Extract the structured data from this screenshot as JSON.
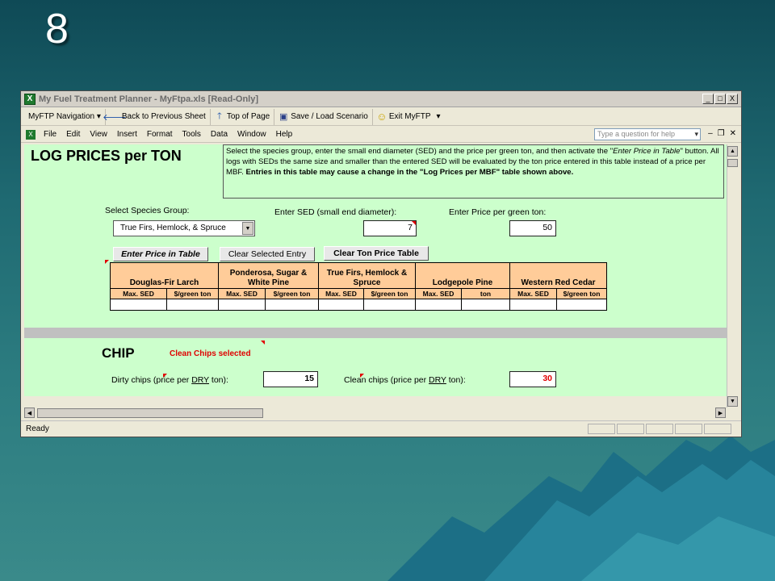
{
  "slide": {
    "number": "8"
  },
  "window": {
    "title": "My Fuel Treatment Planner - MyFtpa.xls  [Read-Only]",
    "buttons": [
      "_",
      "□",
      "X"
    ]
  },
  "toolbar": {
    "items": [
      {
        "label": "MyFTP  Navigation ▾",
        "icon": ""
      },
      {
        "label": "Back to Previous Sheet",
        "icon": "back-arrow-icon"
      },
      {
        "label": "Top of Page",
        "icon": "up-arrow-icon"
      },
      {
        "label": "Save / Load Scenario",
        "icon": "save-icon"
      },
      {
        "label": "Exit MyFTP",
        "icon": "smiley-icon"
      }
    ]
  },
  "menubar": {
    "items": [
      "File",
      "Edit",
      "View",
      "Insert",
      "Format",
      "Tools",
      "Data",
      "Window",
      "Help"
    ],
    "help_placeholder": "Type a question for help"
  },
  "sheet": {
    "log_heading": "LOG PRICES per TON",
    "instructions_plain": "Select the species group, enter the small end diameter (SED) and the price per green ton, and then activate the \"",
    "instructions_italic": "Enter Price in Table",
    "instructions_mid": "\" button.  All logs with SEDs the same size and smaller than the entered SED will be evaluated by the ton price entered in this table instead of a price per MBF.  ",
    "instructions_bold": "Entries in this table may cause a change in the \"Log Prices per MBF\" table shown above.",
    "species_label": "Select Species Group:",
    "species_value": "True Firs, Hemlock, & Spruce",
    "sed_label": "Enter SED (small end diameter):",
    "sed_value": "7",
    "price_label": "Enter Price per green ton:",
    "price_value": "50",
    "btn_enter": "Enter Price in Table",
    "btn_clear_entry": "Clear Selected Entry",
    "btn_clear_table": "Clear Ton Price Table",
    "species_columns": [
      {
        "name": "Douglas-Fir Larch",
        "sub1": "Max. SED",
        "sub2": "$/green ton"
      },
      {
        "name": "Ponderosa, Sugar & White Pine",
        "sub1": "Max. SED",
        "sub2": "$/green ton"
      },
      {
        "name": "True Firs, Hemlock & Spruce",
        "sub1": "Max. SED",
        "sub2": "$/green ton"
      },
      {
        "name": "Lodgepole Pine",
        "sub1": "Max. SED",
        "sub2": "ton"
      },
      {
        "name": "Western Red Cedar",
        "sub1": "Max. SED",
        "sub2": "$/green ton"
      }
    ],
    "chip_heading": "CHIP",
    "chip_status": "Clean Chips selected",
    "dirty_label_a": "Dirty chips (price per ",
    "dirty_label_b": "DRY",
    "dirty_label_c": " ton):",
    "dirty_value": "15",
    "clean_label_a": "Clean chips (price per ",
    "clean_label_b": "DRY",
    "clean_label_c": " ton):",
    "clean_value": "30"
  },
  "status": {
    "text": "Ready"
  },
  "colors": {
    "sheet_bg": "#ccffcc",
    "header_orange": "#ffcc99",
    "alert_red": "#e00000"
  }
}
